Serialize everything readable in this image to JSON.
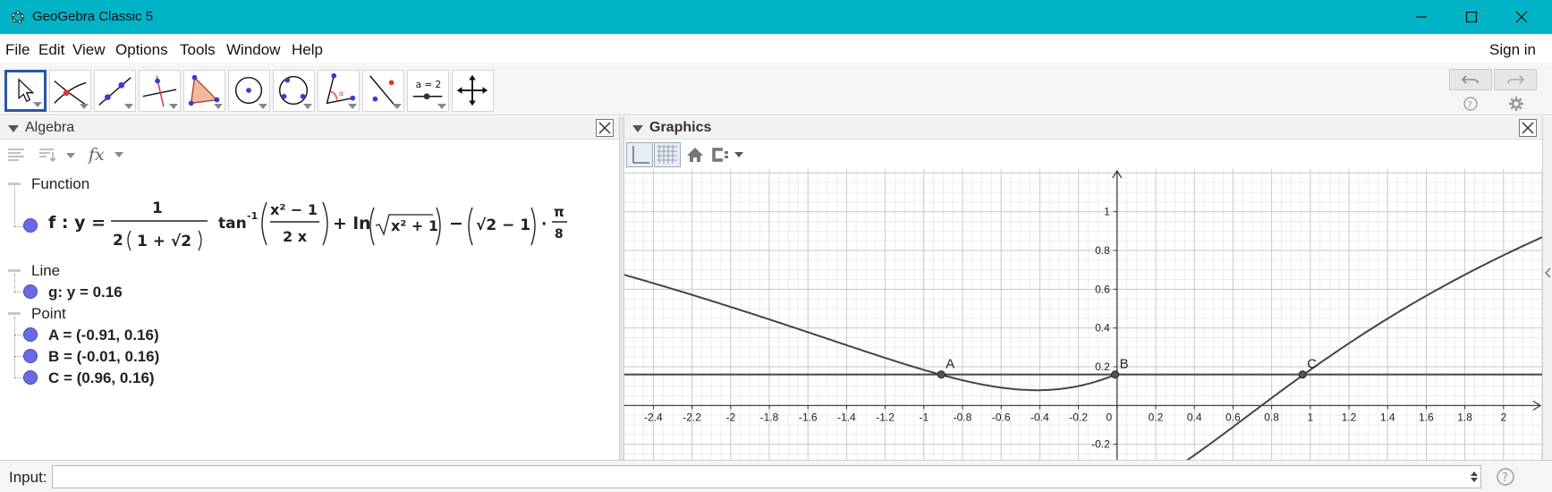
{
  "window": {
    "title": "GeoGebra Classic 5"
  },
  "menu": [
    "File",
    "Edit",
    "View",
    "Options",
    "Tools",
    "Window",
    "Help"
  ],
  "sign_in": "Sign in",
  "toolbar": {
    "tools": [
      "move-tool",
      "point-tool",
      "line-tool",
      "perpendicular-line-tool",
      "polygon-tool",
      "circle-tool",
      "conic-tool",
      "angle-tool",
      "reflect-tool",
      "slider-tool",
      "move-graphics-tool"
    ],
    "slider_label": "a = 2"
  },
  "algebra": {
    "title": "Algebra",
    "groups": [
      {
        "name": "Function",
        "items": [
          {
            "label": "f : y ="
          }
        ]
      },
      {
        "name": "Line",
        "items": [
          {
            "label": "g: y = 0.16"
          }
        ]
      },
      {
        "name": "Point",
        "items": [
          {
            "label": "A = (-0.91, 0.16)"
          },
          {
            "label": "B = (-0.01, 0.16)"
          },
          {
            "label": "C = (0.96, 0.16)"
          }
        ]
      }
    ],
    "formula": {
      "lhs": "f : y =",
      "frac_num": "1",
      "frac_den_a": "2",
      "frac_den_b": "1 + √2",
      "tan": "tan",
      "tan_exp": "-1",
      "arg_num": "x² − 1",
      "arg_den": "2 x",
      "plus_ln": "+ ln",
      "sqrt_arg": "x² + 1",
      "minus": "−",
      "paren_term": "√2 − 1",
      "dot": "·",
      "pi": "π",
      "eight": "8"
    }
  },
  "graphics": {
    "title": "Graphics",
    "x_ticks": [
      "-2.4",
      "-2.2",
      "-2",
      "-1.8",
      "-1.6",
      "-1.4",
      "-1.2",
      "-1",
      "-0.8",
      "-0.6",
      "-0.4",
      "-0.2",
      "0",
      "0.2",
      "0.4",
      "0.6",
      "0.8",
      "1",
      "1.2",
      "1.4",
      "1.6",
      "1.8",
      "2"
    ],
    "y_ticks": [
      "1",
      "0.8",
      "0.6",
      "0.4",
      "0.2",
      "-0.2"
    ],
    "x_range": [
      -2.55,
      2.2
    ],
    "y_range": [
      -0.28,
      1.22
    ],
    "points": [
      {
        "name": "A",
        "x": -0.91,
        "y": 0.16
      },
      {
        "name": "B",
        "x": -0.01,
        "y": 0.16
      },
      {
        "name": "C",
        "x": 0.96,
        "y": 0.16
      }
    ],
    "line_y": 0.16
  },
  "input": {
    "label": "Input:",
    "value": ""
  }
}
